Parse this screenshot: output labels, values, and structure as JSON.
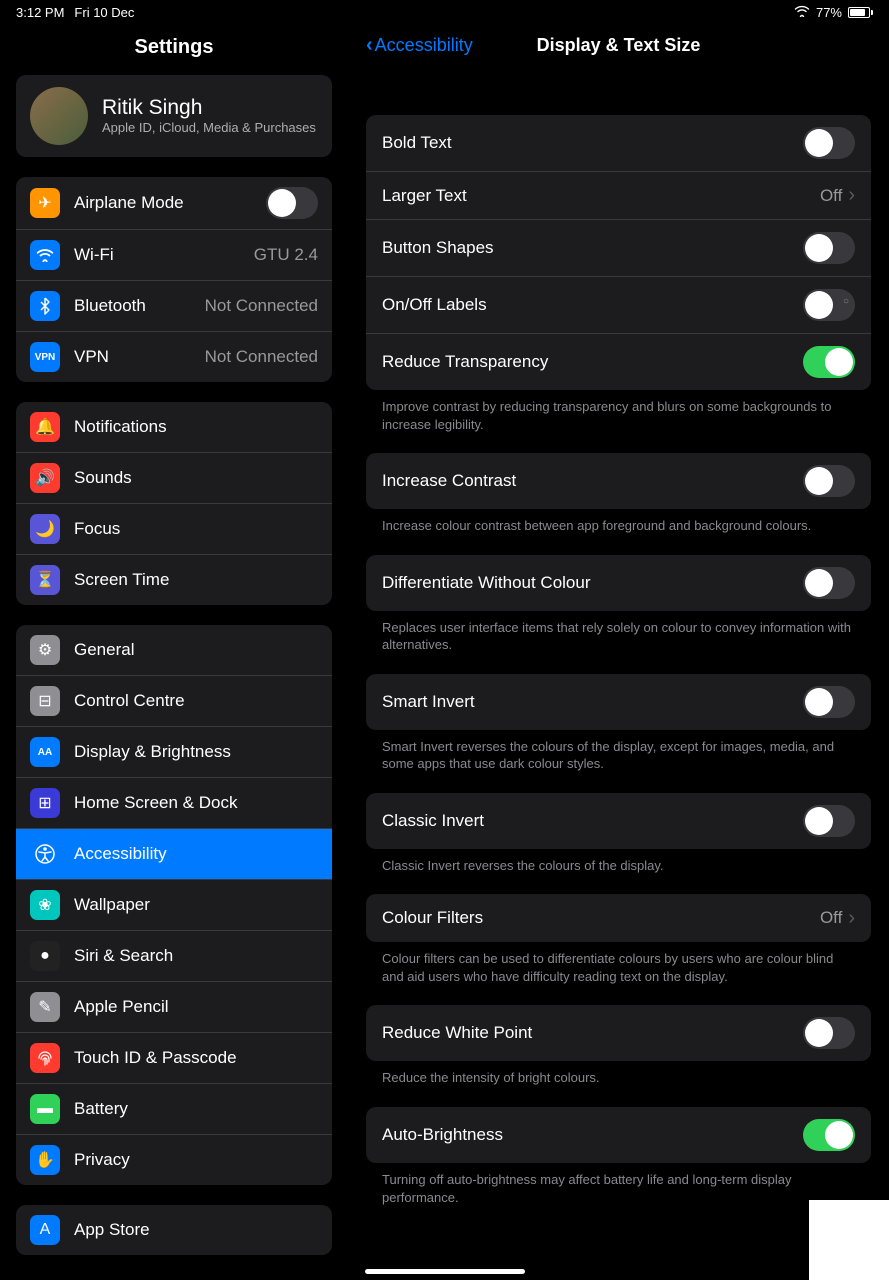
{
  "status": {
    "time": "3:12 PM",
    "date": "Fri 10 Dec",
    "battery": "77%"
  },
  "sidebar": {
    "title": "Settings",
    "profile": {
      "name": "Ritik Singh",
      "sub": "Apple ID, iCloud, Media & Purchases"
    },
    "group1": [
      {
        "icon": "✈",
        "bg": "#ff9500",
        "label": "Airplane Mode",
        "type": "toggle",
        "on": false
      },
      {
        "icon": "wifi",
        "bg": "#007aff",
        "label": "Wi-Fi",
        "value": "GTU 2.4"
      },
      {
        "icon": "bt",
        "bg": "#007aff",
        "label": "Bluetooth",
        "value": "Not Connected"
      },
      {
        "icon": "VPN",
        "bg": "#007aff",
        "label": "VPN",
        "value": "Not Connected",
        "small": true
      }
    ],
    "group2": [
      {
        "icon": "🔔",
        "bg": "#ff3b30",
        "label": "Notifications"
      },
      {
        "icon": "🔊",
        "bg": "#ff3b30",
        "label": "Sounds"
      },
      {
        "icon": "🌙",
        "bg": "#5856d6",
        "label": "Focus"
      },
      {
        "icon": "⏳",
        "bg": "#5856d6",
        "label": "Screen Time"
      }
    ],
    "group3": [
      {
        "icon": "⚙",
        "bg": "#8e8e93",
        "label": "General"
      },
      {
        "icon": "⊟",
        "bg": "#8e8e93",
        "label": "Control Centre"
      },
      {
        "icon": "AA",
        "bg": "#007aff",
        "label": "Display & Brightness",
        "small": true
      },
      {
        "icon": "⊞",
        "bg": "#3a3ad6",
        "label": "Home Screen & Dock"
      },
      {
        "icon": "acc",
        "bg": "#007aff",
        "label": "Accessibility",
        "selected": true
      },
      {
        "icon": "❀",
        "bg": "#00c7be",
        "label": "Wallpaper"
      },
      {
        "icon": "●",
        "bg": "#222",
        "label": "Siri & Search"
      },
      {
        "icon": "✎",
        "bg": "#8e8e93",
        "label": "Apple Pencil"
      },
      {
        "icon": "fp",
        "bg": "#ff3b30",
        "label": "Touch ID & Passcode"
      },
      {
        "icon": "▬",
        "bg": "#30d158",
        "label": "Battery"
      },
      {
        "icon": "✋",
        "bg": "#007aff",
        "label": "Privacy"
      }
    ],
    "group4": [
      {
        "icon": "A",
        "bg": "#007aff",
        "label": "App Store"
      }
    ]
  },
  "detail": {
    "back": "Accessibility",
    "title": "Display & Text Size",
    "sections": [
      {
        "rows": [
          {
            "label": "Bold Text",
            "type": "toggle",
            "on": false
          },
          {
            "label": "Larger Text",
            "type": "link",
            "value": "Off"
          },
          {
            "label": "Button Shapes",
            "type": "toggle",
            "on": false
          },
          {
            "label": "On/Off Labels",
            "type": "toggle",
            "on": false,
            "labeled": true
          },
          {
            "label": "Reduce Transparency",
            "type": "toggle",
            "on": true
          }
        ],
        "footer": "Improve contrast by reducing transparency and blurs on some backgrounds to increase legibility."
      },
      {
        "rows": [
          {
            "label": "Increase Contrast",
            "type": "toggle",
            "on": false
          }
        ],
        "footer": "Increase colour contrast between app foreground and background colours."
      },
      {
        "rows": [
          {
            "label": "Differentiate Without Colour",
            "type": "toggle",
            "on": false
          }
        ],
        "footer": "Replaces user interface items that rely solely on colour to convey information with alternatives."
      },
      {
        "rows": [
          {
            "label": "Smart Invert",
            "type": "toggle",
            "on": false
          }
        ],
        "footer": "Smart Invert reverses the colours of the display, except for images, media, and some apps that use dark colour styles."
      },
      {
        "rows": [
          {
            "label": "Classic Invert",
            "type": "toggle",
            "on": false
          }
        ],
        "footer": "Classic Invert reverses the colours of the display."
      },
      {
        "rows": [
          {
            "label": "Colour Filters",
            "type": "link",
            "value": "Off"
          }
        ],
        "footer": "Colour filters can be used to differentiate colours by users who are colour blind and aid users who have difficulty reading text on the display."
      },
      {
        "rows": [
          {
            "label": "Reduce White Point",
            "type": "toggle",
            "on": false
          }
        ],
        "footer": "Reduce the intensity of bright colours."
      },
      {
        "rows": [
          {
            "label": "Auto-Brightness",
            "type": "toggle",
            "on": true
          }
        ],
        "footer": "Turning off auto-brightness may affect battery life and long-term display performance."
      }
    ]
  }
}
